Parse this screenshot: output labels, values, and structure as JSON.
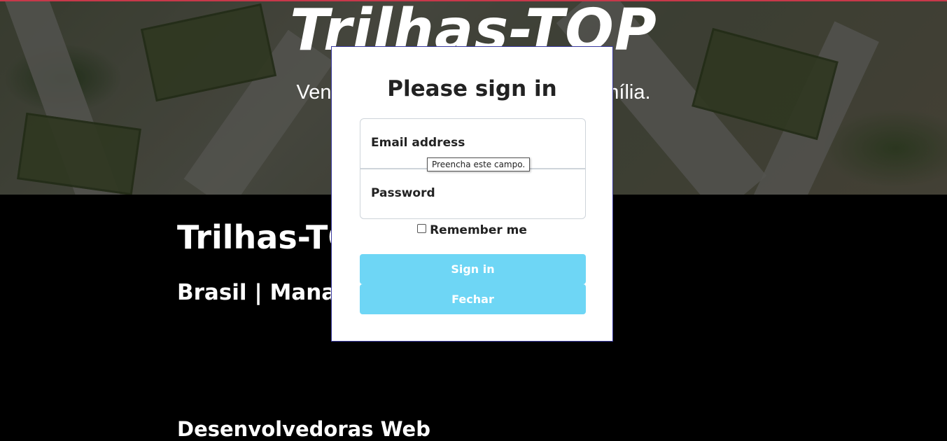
{
  "hero": {
    "title": "Trilhas-TOP",
    "subtitle": "Venha                                         família."
  },
  "content": {
    "title": "Trilhas-TO",
    "location": "Brasil | Manaus",
    "devs": "Desenvolvedoras Web"
  },
  "modal": {
    "title": "Please sign in",
    "email_label": "Email address",
    "password_label": "Password",
    "validation_tooltip": "Preencha este campo.",
    "remember_label": "Remember me",
    "signin_label": "Sign in",
    "close_label": "Fechar"
  },
  "colors": {
    "accent_strip": "#c8384a",
    "button": "#6ed6f5",
    "modal_border": "#3a3aa0"
  }
}
